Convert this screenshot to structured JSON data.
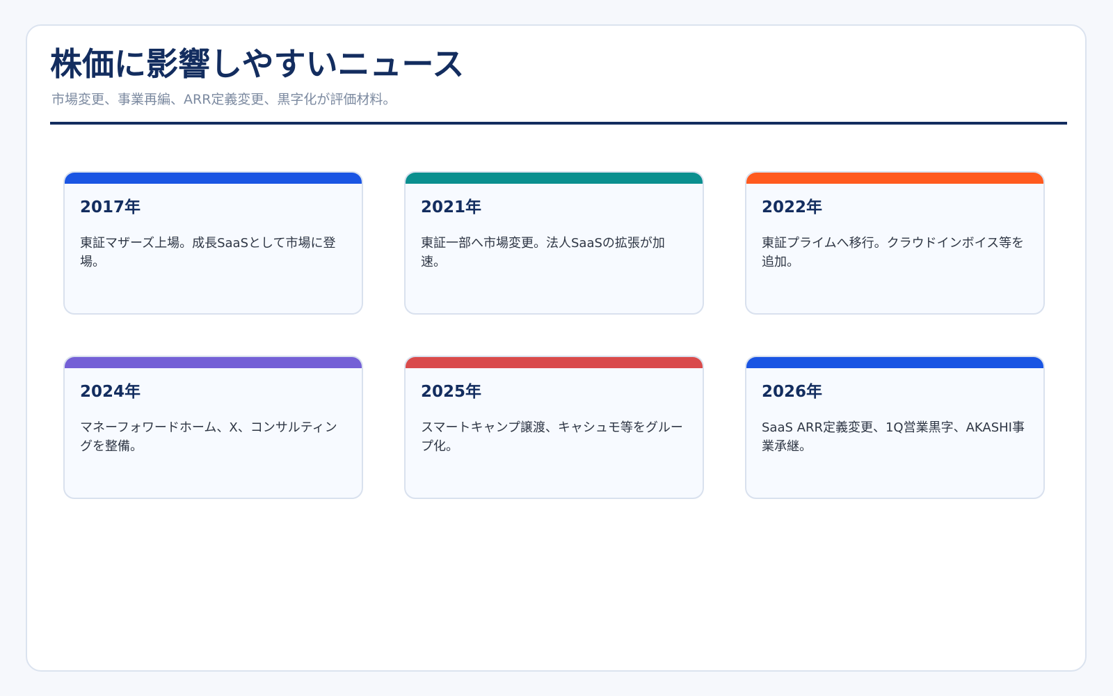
{
  "header": {
    "title": "株価に影響しやすいニュース",
    "subtitle": "市場変更、事業再編、ARR定義変更、黒字化が評価材料。"
  },
  "colors": {
    "navy": "#132d5f",
    "blue": "#1a55e3",
    "teal": "#0a8f8f",
    "orange": "#ff5a1f",
    "purple": "#7460d6",
    "red": "#d94b4b"
  },
  "cards": [
    {
      "year": "2017年",
      "text": "東証マザーズ上場。成長SaaSとして市場に登場。",
      "accent": "#1a55e3"
    },
    {
      "year": "2021年",
      "text": "東証一部へ市場変更。法人SaaSの拡張が加速。",
      "accent": "#0a8f8f"
    },
    {
      "year": "2022年",
      "text": "東証プライムへ移行。クラウドインボイス等を追加。",
      "accent": "#ff5a1f"
    },
    {
      "year": "2024年",
      "text": "マネーフォワードホーム、X、コンサルティングを整備。",
      "accent": "#7460d6"
    },
    {
      "year": "2025年",
      "text": "スマートキャンプ譲渡、キャシュモ等をグループ化。",
      "accent": "#d94b4b"
    },
    {
      "year": "2026年",
      "text": "SaaS ARR定義変更、1Q営業黒字、AKASHI事業承継。",
      "accent": "#1a55e3"
    }
  ]
}
